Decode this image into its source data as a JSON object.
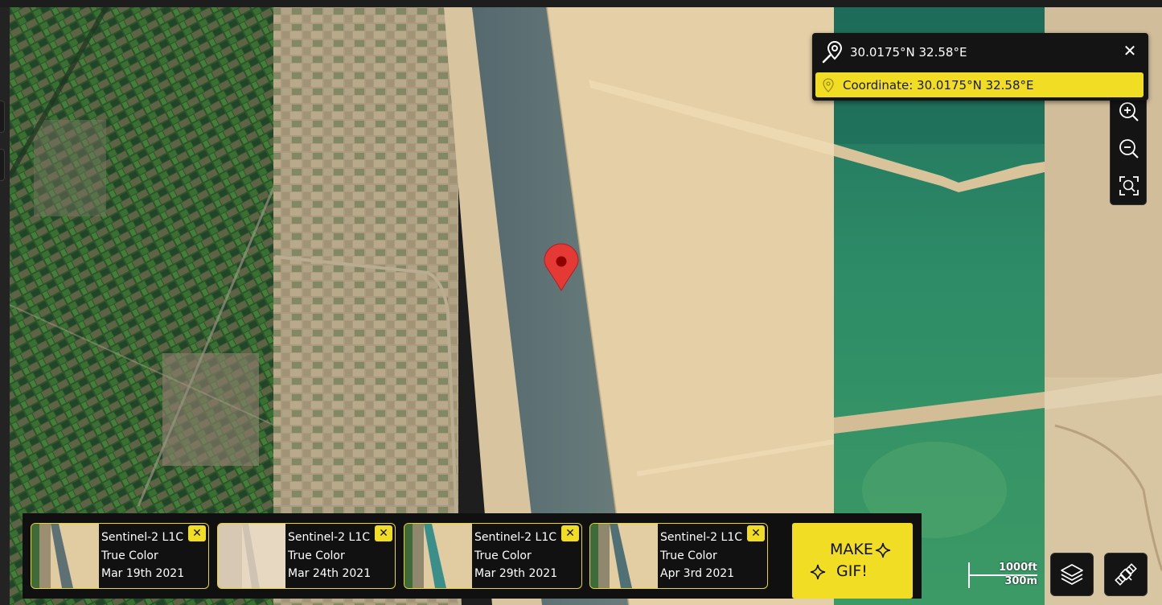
{
  "search": {
    "query": "30.0175°N 32.58°E",
    "clear_label": "✕",
    "result_text": "Coordinate: 30.0175°N 32.58°E"
  },
  "map": {
    "marker_icon": "map-pin-icon",
    "colors": {
      "accent": "#f0dd24",
      "marker": "#e53935",
      "canal": "#5d7175",
      "sea": "#2e8c67",
      "desert": "#e5cfa6"
    }
  },
  "zoom": {
    "in_icon": "zoom-in-icon",
    "out_icon": "zoom-out-icon",
    "fit_icon": "zoom-fit-icon"
  },
  "timeline": {
    "cards": [
      {
        "line1": "Sentinel-2 L1C",
        "line2": "True Color",
        "date": "Mar 19th 2021"
      },
      {
        "line1": "Sentinel-2 L1C",
        "line2": "True Color",
        "date": "Mar 24th 2021"
      },
      {
        "line1": "Sentinel-2 L1C",
        "line2": "True Color",
        "date": "Mar 29th 2021"
      },
      {
        "line1": "Sentinel-2 L1C",
        "line2": "True Color",
        "date": "Apr 3rd 2021"
      }
    ],
    "close_label": "✕",
    "gif_line1": "MAKE",
    "gif_line2": "GIF!"
  },
  "scale": {
    "imperial": "1000ft",
    "metric": "300m"
  },
  "controls": {
    "layers_icon": "layers-icon",
    "satellite_icon": "satellite-icon"
  }
}
